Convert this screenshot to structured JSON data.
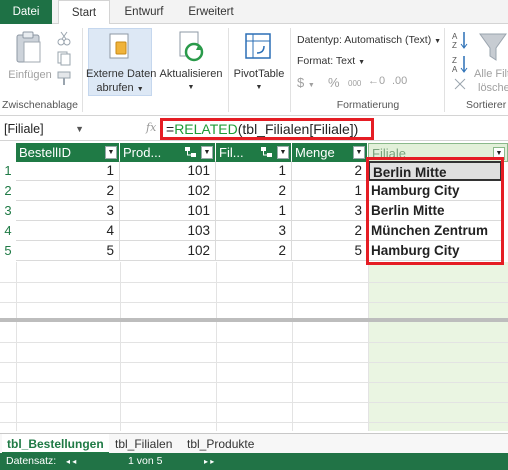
{
  "ribbon": {
    "tabs": [
      "Datei",
      "Start",
      "Entwurf",
      "Erweitert"
    ],
    "active_tab": "Start",
    "paste_label": "Einfügen",
    "clipboard_group": "Zwischenablage",
    "external_data_line1": "Externe Daten",
    "external_data_line2": "abrufen",
    "refresh_label": "Aktualisieren",
    "pivot_label": "PivotTable",
    "datatype_label": "Datentyp: Automatisch (Text)",
    "format_label": "Format: Text",
    "currency_symbol": "$",
    "percent_symbol": "%",
    "thousands_symbol": "000",
    "formatting_group": "Formatierung",
    "filter_line1": "Alle Filte",
    "filter_line2": "löschen",
    "sort_group": "Sortierer"
  },
  "formula_bar": {
    "name_box": "[Filiale]",
    "fx": "fx",
    "formula_eq": "=",
    "formula_fn": "RELATED",
    "formula_rest": "(tbl_Filialen[Filiale])"
  },
  "table": {
    "headers": [
      "BestellID",
      "Prod...",
      "Fil...",
      "Menge",
      "Filiale"
    ],
    "row_numbers": [
      "1",
      "2",
      "3",
      "4",
      "5"
    ],
    "rows": [
      {
        "bestellid": "1",
        "produkt": "101",
        "filiale_id": "1",
        "menge": "2",
        "filiale": "Berlin Mitte"
      },
      {
        "bestellid": "2",
        "produkt": "102",
        "filiale_id": "2",
        "menge": "1",
        "filiale": "Hamburg City"
      },
      {
        "bestellid": "3",
        "produkt": "101",
        "filiale_id": "1",
        "menge": "3",
        "filiale": "Berlin Mitte"
      },
      {
        "bestellid": "4",
        "produkt": "103",
        "filiale_id": "3",
        "menge": "2",
        "filiale": "München Zentrum"
      },
      {
        "bestellid": "5",
        "produkt": "102",
        "filiale_id": "2",
        "menge": "5",
        "filiale": "Hamburg City"
      }
    ]
  },
  "sheets": [
    "tbl_Bestellungen",
    "tbl_Filialen",
    "tbl_Produkte"
  ],
  "active_sheet": "tbl_Bestellungen",
  "status": {
    "record_label": "Datensatz:",
    "record_position": "1 von 5"
  },
  "colors": {
    "accent_green": "#217346",
    "header_green": "#1f7a45",
    "highlight_red": "#e51d24"
  }
}
